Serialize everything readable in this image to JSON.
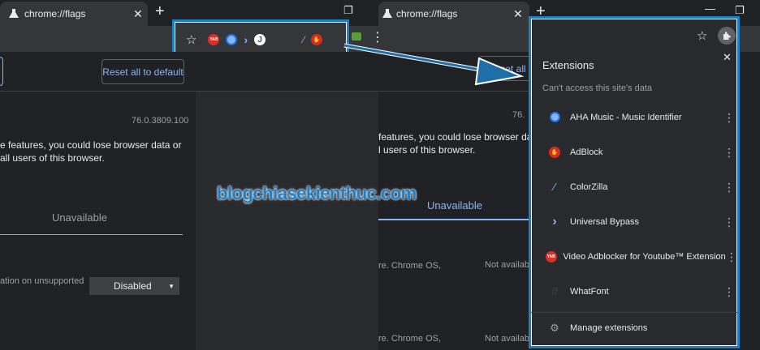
{
  "left_window": {
    "tab_title": "chrome://flags",
    "reset_button": "Reset all to default",
    "version": "76.0.3809.100",
    "warning_line1": "e features, you could lose browser data or",
    "warning_line2": "all users of this browser.",
    "unavailable_tab": "Unavailable",
    "row_text": "ation on unsupported",
    "select_value": "Disabled"
  },
  "right_window": {
    "tab_title": "chrome://flags",
    "reset_button_partial": "Reset all t",
    "version_partial": "76.",
    "warning_line1": "features, you could lose browser data",
    "warning_line2": "l users of this browser.",
    "unavailable_tab": "Unavailable",
    "row1_text": "re. Chrome OS,",
    "row1_status": "Not availab",
    "row2_text": "re. Chrome OS,",
    "row2_status": "Not availab"
  },
  "toolbar_icons": [
    "star-icon",
    "yab-icon",
    "aha-music-icon",
    "universal-bypass-icon",
    "whatfont-icon",
    "colorzilla-icon",
    "adblock-icon"
  ],
  "extensions_menu": {
    "title": "Extensions",
    "subtitle": "Can't access this site's data",
    "items": [
      {
        "name": "AHA Music - Music Identifier",
        "icon": "aha-music-icon"
      },
      {
        "name": "AdBlock",
        "icon": "adblock-icon"
      },
      {
        "name": "ColorZilla",
        "icon": "colorzilla-icon"
      },
      {
        "name": "Universal Bypass",
        "icon": "universal-bypass-icon"
      },
      {
        "name": "Video Adblocker for Youtube™ Extension",
        "icon": "yab-icon"
      },
      {
        "name": "WhatFont",
        "icon": "whatfont-icon"
      }
    ],
    "manage": "Manage extensions"
  },
  "yab_label": "YAB",
  "watermark": "blogchiasekienthuc.com",
  "colors": {
    "accent": "#8ab4f8",
    "frame": "#1e7fc8",
    "adblock": "#d62d20",
    "yab": "#d93025"
  }
}
